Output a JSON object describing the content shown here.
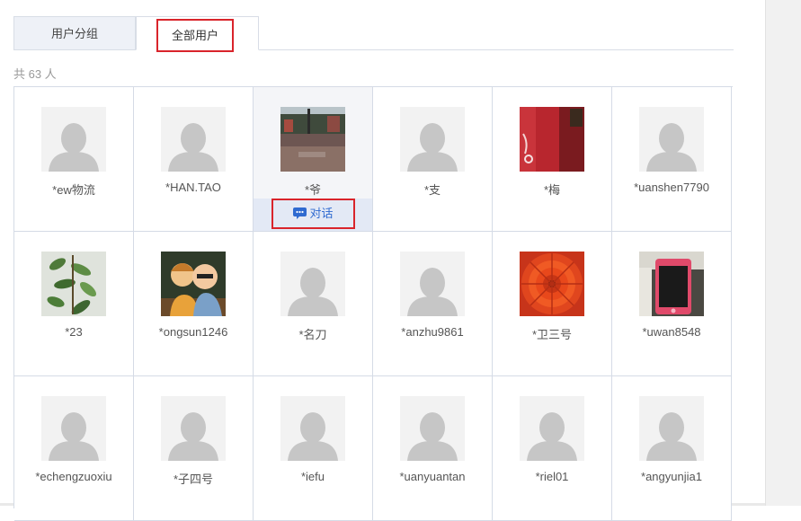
{
  "tabs": [
    {
      "label": "用户分组",
      "active": false
    },
    {
      "label": "全部用户",
      "active": true
    }
  ],
  "count_text": "共 63 人",
  "chat_label": "对话",
  "highlight_color": "#d9242b",
  "users": [
    {
      "name": "*ew物流",
      "avatar": "default"
    },
    {
      "name": "*HAN.TAO",
      "avatar": "default"
    },
    {
      "name": "*爷",
      "avatar": "photo-street",
      "hover": true
    },
    {
      "name": "*支",
      "avatar": "default"
    },
    {
      "name": "*梅",
      "avatar": "photo-red-cup"
    },
    {
      "name": "*uanshen7790",
      "avatar": "default"
    },
    {
      "name": "*23",
      "avatar": "photo-plant"
    },
    {
      "name": "*ongsun1246",
      "avatar": "photo-cartoon-couple"
    },
    {
      "name": "*名刀",
      "avatar": "default"
    },
    {
      "name": "*anzhu9861",
      "avatar": "default"
    },
    {
      "name": "*卫三号",
      "avatar": "photo-red-flower"
    },
    {
      "name": "*uwan8548",
      "avatar": "photo-phone"
    },
    {
      "name": "*echengzuoxiu",
      "avatar": "default"
    },
    {
      "name": "*子四号",
      "avatar": "default"
    },
    {
      "name": "*iefu",
      "avatar": "default"
    },
    {
      "name": "*uanyuantan",
      "avatar": "default"
    },
    {
      "name": "*riel01",
      "avatar": "default"
    },
    {
      "name": "*angyunjia1",
      "avatar": "default"
    }
  ]
}
